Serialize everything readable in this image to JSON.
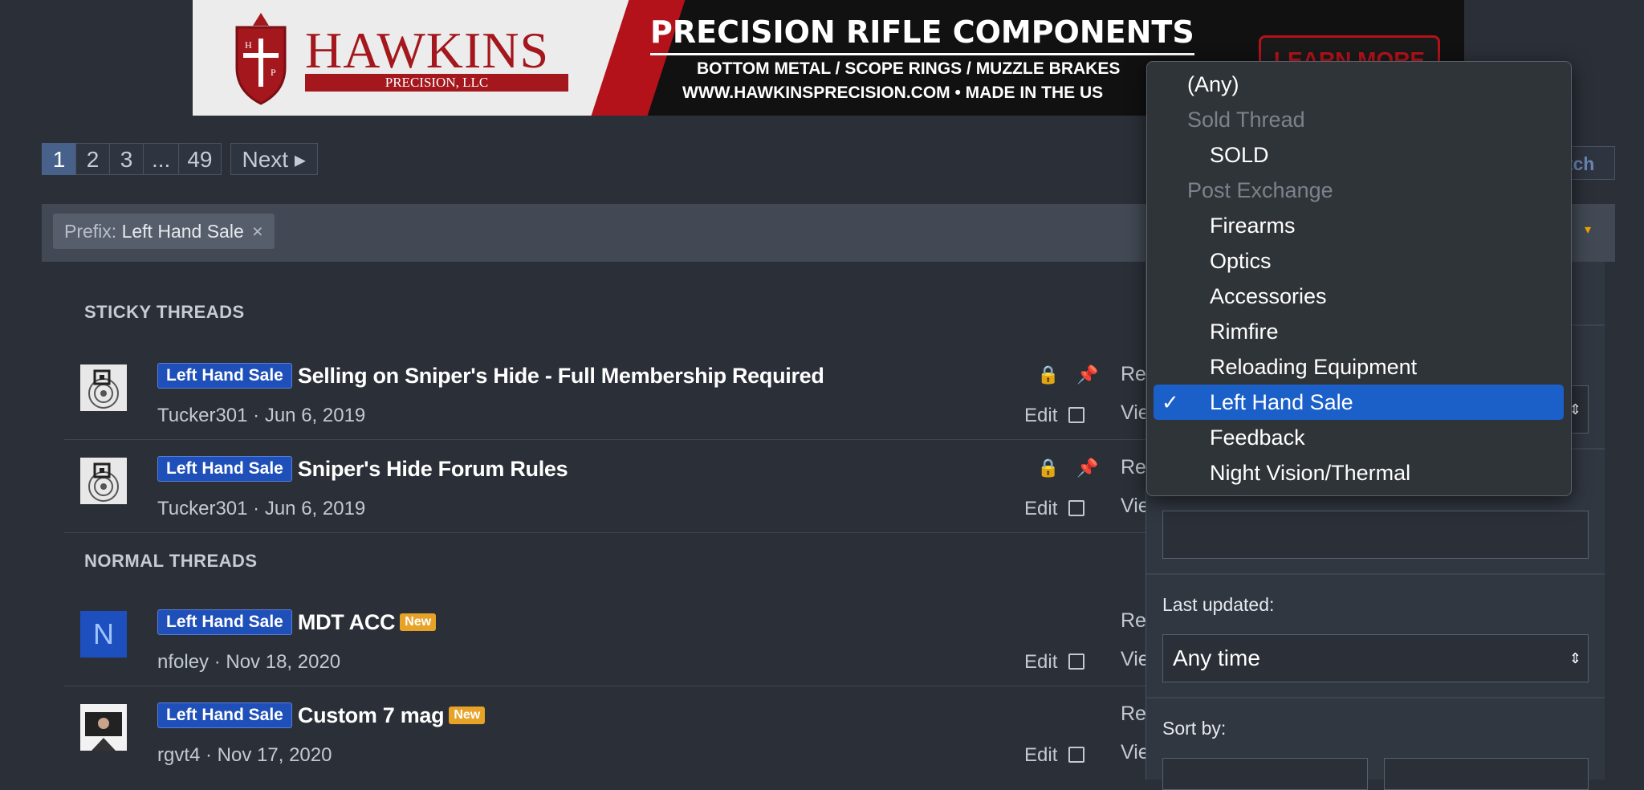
{
  "banner": {
    "brand": "HAWKINS",
    "brand_sub": "PRECISION, LLC",
    "headline": "PRECISION RIFLE COMPONENTS",
    "line1": "BOTTOM METAL / SCOPE RINGS / MUZZLE BRAKES",
    "line2": "WWW.HAWKINSPRECISION.COM • MADE IN THE US",
    "cta": "LEARN MORE",
    "colors": {
      "brand_red": "#a3171d"
    }
  },
  "pagination": {
    "pages": [
      "1",
      "2",
      "3",
      "...",
      "49"
    ],
    "next": "Next ▸"
  },
  "watch_button": "atch",
  "filter_bar": {
    "prefix_label": "Prefix:",
    "prefix_value": "Left Hand Sale",
    "close_icon": "×",
    "caret": "▾"
  },
  "sections": {
    "sticky": "STICKY THREADS",
    "normal": "NORMAL THREADS"
  },
  "threads": [
    {
      "prefix": "Left Hand Sale",
      "title": "Selling on Sniper's Hide - Full Membership Required",
      "meta": "Tucker301 · Jun 6, 2019",
      "edit": "Edit",
      "stat1": "Re",
      "stat2": "Vie",
      "locked": true,
      "pinned": true,
      "avatar": "target-icon"
    },
    {
      "prefix": "Left Hand Sale",
      "title": "Sniper's Hide Forum Rules",
      "meta": "Tucker301 · Jun 6, 2019",
      "edit": "Edit",
      "stat1": "Re",
      "stat2": "Vie",
      "locked": true,
      "pinned": true,
      "avatar": "target-icon"
    },
    {
      "prefix": "Left Hand Sale",
      "title": "MDT ACC",
      "badge": "New",
      "meta": "nfoley · Nov 18, 2020",
      "edit": "Edit",
      "stat1": "Re",
      "stat2": "Vie",
      "avatar_letter": "N"
    },
    {
      "prefix": "Left Hand Sale",
      "title": "Custom 7 mag",
      "badge": "New",
      "meta": "rgvt4 · Nov 17, 2020",
      "edit": "Edit",
      "stat1": "Re",
      "stat2": "Vie",
      "avatar": "photo"
    }
  ],
  "icons": {
    "lock": "🔒",
    "pin": "📌"
  },
  "filter_panel": {
    "last_updated_label": "Last updated:",
    "last_updated_value": "Any time",
    "sort_label": "Sort by:",
    "updown": "⇕"
  },
  "dropdown": {
    "options": [
      {
        "label": "(Any)",
        "kind": "option"
      },
      {
        "label": "Sold Thread",
        "kind": "group"
      },
      {
        "label": "SOLD",
        "kind": "sub"
      },
      {
        "label": "Post Exchange",
        "kind": "group"
      },
      {
        "label": "Firearms",
        "kind": "sub"
      },
      {
        "label": "Optics",
        "kind": "sub"
      },
      {
        "label": "Accessories",
        "kind": "sub"
      },
      {
        "label": "Rimfire",
        "kind": "sub"
      },
      {
        "label": "Reloading Equipment",
        "kind": "sub"
      },
      {
        "label": "Left Hand Sale",
        "kind": "sub",
        "selected": true
      },
      {
        "label": "Feedback",
        "kind": "sub"
      },
      {
        "label": "Night Vision/Thermal",
        "kind": "sub"
      }
    ],
    "check": "✓",
    "selected_color": "#1b5fc9"
  }
}
